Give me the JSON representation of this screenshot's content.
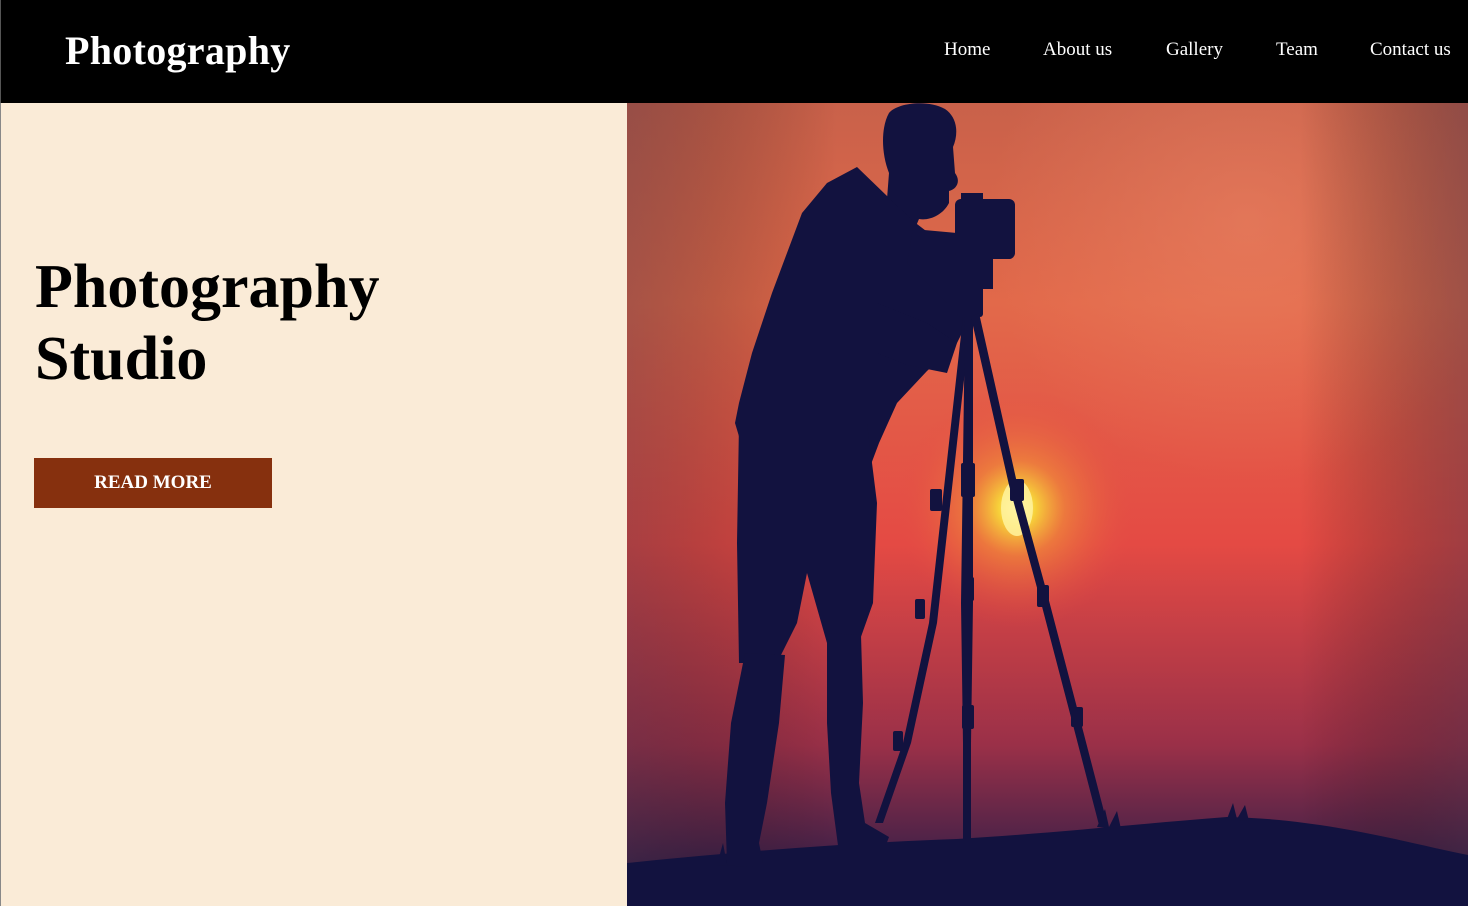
{
  "header": {
    "brand": "Photography",
    "nav": [
      "Home",
      "About us",
      "Gallery",
      "Team",
      "Contact us"
    ]
  },
  "hero": {
    "title_line1": "Photography",
    "title_line2": "Studio",
    "button_label": "READ MORE",
    "image_subject": "silhouette of photographer with camera on tripod at sunset"
  },
  "colors": {
    "nav_bg": "#000000",
    "panel_bg": "#faebd7",
    "button_bg": "#86300e",
    "silhouette": "#12123f"
  }
}
